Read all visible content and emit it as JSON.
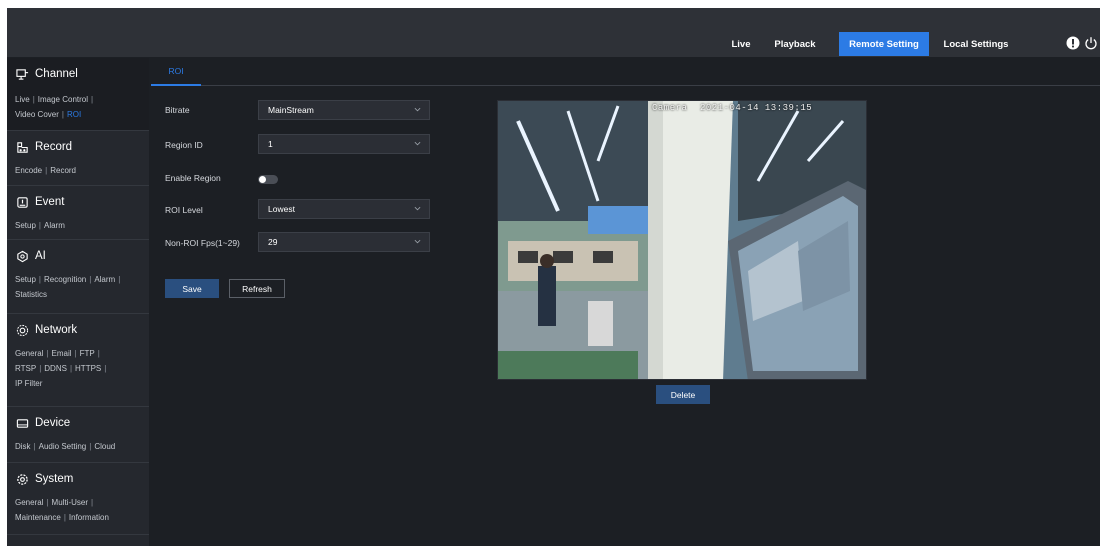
{
  "topnav": {
    "items": [
      {
        "label": "Live",
        "active": false
      },
      {
        "label": "Playback",
        "active": false
      },
      {
        "label": "Remote Setting",
        "active": true
      },
      {
        "label": "Local Settings",
        "active": false
      }
    ],
    "icons": [
      "alert-icon",
      "power-icon"
    ]
  },
  "sidebar": {
    "sections": [
      {
        "title": "Channel",
        "icon": "channel-icon",
        "links": [
          "Live",
          "Image Control",
          "Video Cover",
          "ROI"
        ],
        "current": "ROI"
      },
      {
        "title": "Record",
        "icon": "record-icon",
        "links": [
          "Encode",
          "Record"
        ]
      },
      {
        "title": "Event",
        "icon": "event-icon",
        "links": [
          "Setup",
          "Alarm"
        ]
      },
      {
        "title": "AI",
        "icon": "ai-icon",
        "links": [
          "Setup",
          "Recognition",
          "Alarm",
          "Statistics"
        ]
      },
      {
        "title": "Network",
        "icon": "network-icon",
        "links": [
          "General",
          "Email",
          "FTP",
          "RTSP",
          "DDNS",
          "HTTPS",
          "IP Filter"
        ]
      },
      {
        "title": "Device",
        "icon": "device-icon",
        "links": [
          "Disk",
          "Audio Setting",
          "Cloud"
        ]
      },
      {
        "title": "System",
        "icon": "system-icon",
        "links": [
          "General",
          "Multi-User",
          "Maintenance",
          "Information"
        ]
      }
    ]
  },
  "main": {
    "tab": "ROI",
    "form": {
      "bitrate": {
        "label": "Bitrate",
        "value": "MainStream"
      },
      "region_id": {
        "label": "Region ID",
        "value": "1"
      },
      "enable_region": {
        "label": "Enable Region",
        "enabled": false
      },
      "roi_level": {
        "label": "ROI Level",
        "value": "Lowest"
      },
      "non_roi_fps": {
        "label": "Non-ROI Fps(1~29)",
        "value": "29"
      }
    },
    "buttons": {
      "save": "Save",
      "refresh": "Refresh",
      "delete": "Delete"
    },
    "preview": {
      "camera_name": "Camera",
      "timestamp": "2021-04-14 13:39:15"
    }
  },
  "colors": {
    "accent": "#2c7be5",
    "topbar": "#2e3137",
    "sidebar": "#25282e",
    "background": "#1c1f24",
    "roi_box": "#5b95d6"
  }
}
